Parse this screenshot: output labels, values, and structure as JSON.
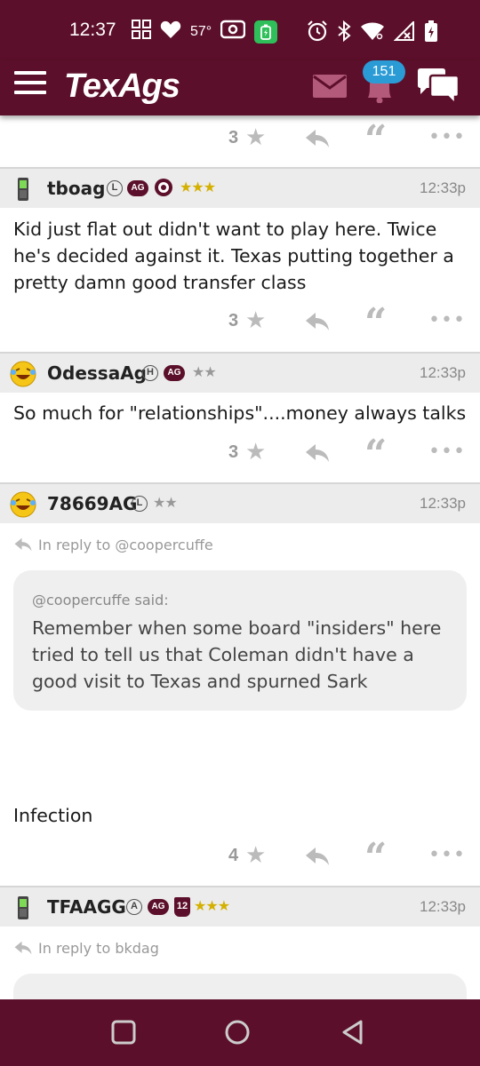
{
  "status_bar": {
    "time": "12:37",
    "temperature": "57°",
    "icons": [
      "grid-icon",
      "heart-icon",
      "radio-icon",
      "battery-saver-icon",
      "alarm-icon",
      "bluetooth-icon",
      "wifi-icon",
      "signal-icon",
      "battery-icon"
    ]
  },
  "header": {
    "logo": "TexAgs",
    "notification_count": "151",
    "icons": [
      "menu-icon",
      "mail-icon",
      "bell-icon",
      "chat-icon"
    ]
  },
  "colors": {
    "brand": "#5c0f2a",
    "badge_blue": "#2b9bd6",
    "gold_star": "#d4b000"
  },
  "posts": [
    {
      "actions": {
        "stars": "3"
      }
    },
    {
      "username": "tboag",
      "badges": [
        "L",
        "AG"
      ],
      "stars": "★★★",
      "time": "12:33p",
      "body": "Kid just flat out didn't want to play here. Twice he's decided against it. Texas putting together a pretty damn good transfer class",
      "actions": {
        "stars": "3"
      }
    },
    {
      "username": "OdessaAg",
      "badges": [
        "H",
        "AG"
      ],
      "stars": "★★",
      "time": "12:33p",
      "body": "So much for \"relationships\"....money always talks",
      "actions": {
        "stars": "3"
      }
    },
    {
      "username": "78669AG",
      "badges": [
        "L"
      ],
      "stars": "★★",
      "time": "12:33p",
      "reply_to": "In reply to @coopercuffe",
      "quote_said": "@coopercuffe said:",
      "quote_text": "Remember when some board \"insiders\" here tried to tell us that Coleman didn't have a good visit to Texas and spurned Sark",
      "body": "Infection",
      "actions": {
        "stars": "4"
      }
    },
    {
      "username": "TFAAGG",
      "badges": [
        "A",
        "AG",
        "12"
      ],
      "stars": "★★★",
      "time": "12:33p",
      "reply_to": "In reply to bkdag"
    }
  ]
}
